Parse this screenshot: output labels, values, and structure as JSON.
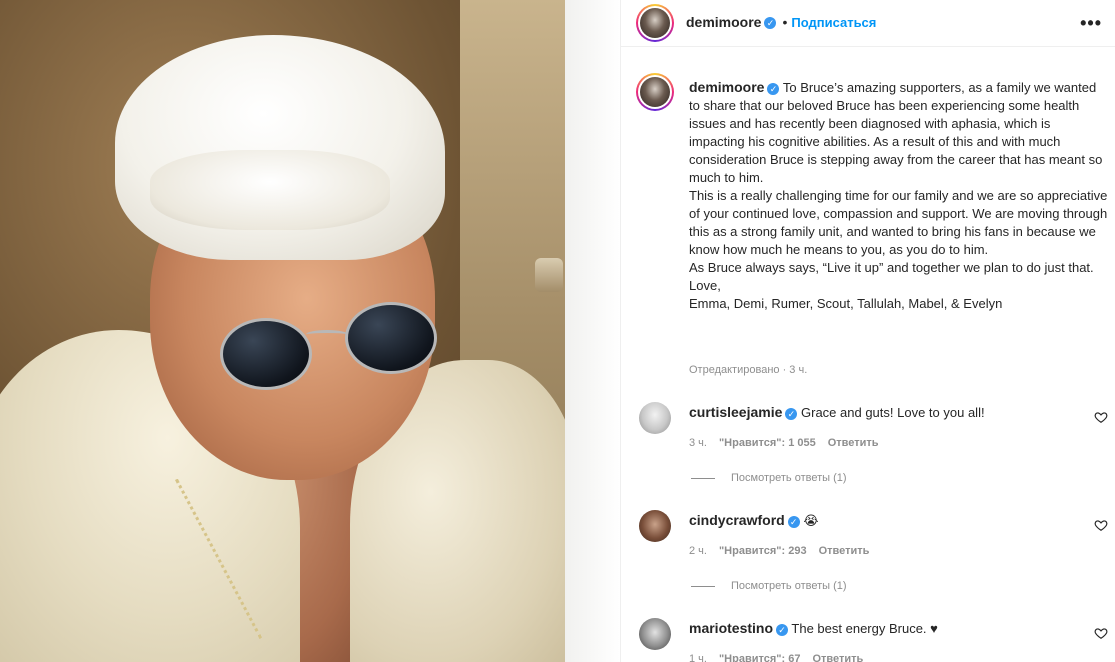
{
  "post": {
    "author": "demimoore",
    "verified": true,
    "follow_label": "Подписаться",
    "more_label": "•••"
  },
  "caption": {
    "author": "demimoore",
    "paragraphs": [
      "To Bruce’s amazing supporters, as a family we wanted to share that our beloved Bruce has been experiencing some health issues and has recently been diagnosed with aphasia, which is impacting his cognitive abilities. As a result of this and with much consideration Bruce is stepping away from the career that has meant so much to him.",
      "This is a really challenging time for our family and we are so appreciative of your continued love, compassion and support. We are moving through this as a strong family unit, and wanted to bring his fans in because we know how much he means to you, as you do to him.",
      "As Bruce always says, “Live it up” and together we plan to do just that.",
      "Love,",
      "Emma, Demi, Rumer, Scout, Tallulah, Mabel, & Evelyn"
    ],
    "edited_label": "Отредактировано · 3 ч."
  },
  "comments": [
    {
      "author": "curtisleejamie",
      "text": "Grace and guts! Love to you all!",
      "time": "3 ч.",
      "likes": "\"Нравится\": 1 055",
      "reply_label": "Ответить",
      "view_replies": "Посмотреть ответы (1)"
    },
    {
      "author": "cindycrawford",
      "text": "😭",
      "time": "2 ч.",
      "likes": "\"Нравится\": 293",
      "reply_label": "Ответить",
      "view_replies": "Посмотреть ответы (1)"
    },
    {
      "author": "mariotestino",
      "text": "The best energy Bruce. ♥",
      "time": "1 ч.",
      "likes": "\"Нравится\": 67",
      "reply_label": "Ответить"
    }
  ],
  "icons": {
    "verified": "✓",
    "heart": "heart-outline-icon"
  },
  "colors": {
    "link_blue": "#0095f6",
    "verified_blue": "#3897f0",
    "muted": "#8e8e8e"
  }
}
